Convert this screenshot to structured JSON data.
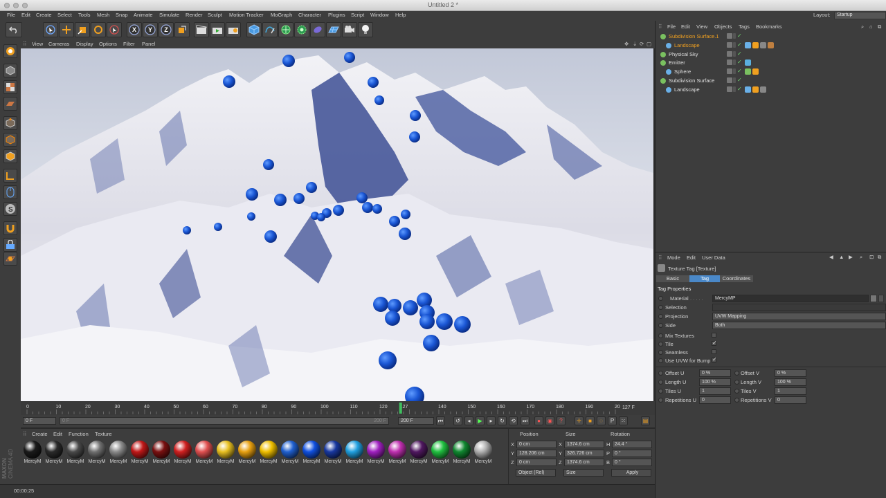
{
  "window": {
    "title": "Untitled 2 *"
  },
  "menubar": {
    "items": [
      "File",
      "Edit",
      "Create",
      "Select",
      "Tools",
      "Mesh",
      "Snap",
      "Animate",
      "Simulate",
      "Render",
      "Sculpt",
      "Motion Tracker",
      "MoGraph",
      "Character",
      "Plugins",
      "Script",
      "Window",
      "Help"
    ],
    "layout_label": "Layout:",
    "layout_value": "Startup"
  },
  "toolbar": {
    "axis_labels": [
      "X",
      "Y",
      "Z"
    ]
  },
  "viewport": {
    "menu": [
      "View",
      "Cameras",
      "Display",
      "Options",
      "Filter",
      "Panel"
    ]
  },
  "timeline": {
    "ticks": [
      "0",
      "10",
      "20",
      "30",
      "40",
      "50",
      "60",
      "70",
      "80",
      "90",
      "100",
      "110",
      "120",
      "127",
      "140",
      "150",
      "160",
      "170",
      "180",
      "190",
      "200"
    ],
    "current_frame_value": 127,
    "frame_display": "127 F"
  },
  "transport": {
    "start_frame": "0 F",
    "range_start": "0 F",
    "range_end": "200 F",
    "end_frame": "200 F"
  },
  "material_manager": {
    "menu": [
      "Create",
      "Edit",
      "Function",
      "Texture"
    ],
    "logo_line1": "MAXON",
    "logo_line2": "CINEMA 4D",
    "materials": [
      {
        "label": "MercyM",
        "color": "#1a1a1a"
      },
      {
        "label": "MercyM",
        "color": "#2a2a2a"
      },
      {
        "label": "MercyM",
        "color": "#4a4a4a"
      },
      {
        "label": "MercyM",
        "color": "#707070"
      },
      {
        "label": "MercyM",
        "color": "#8a8a8a"
      },
      {
        "label": "MercyM",
        "color": "#c01818"
      },
      {
        "label": "MercyM",
        "color": "#7a1010"
      },
      {
        "label": "MercyM",
        "color": "#d02020"
      },
      {
        "label": "MercyM",
        "color": "#e05050"
      },
      {
        "label": "MercyM",
        "color": "#e8c020"
      },
      {
        "label": "MercyM",
        "color": "#e8a010"
      },
      {
        "label": "MercyM",
        "color": "#f0c000"
      },
      {
        "label": "MercyM",
        "color": "#2060d0"
      },
      {
        "label": "MercyM",
        "color": "#1050e0"
      },
      {
        "label": "MercyM",
        "color": "#1838a0"
      },
      {
        "label": "MercyM",
        "color": "#20a0e0"
      },
      {
        "label": "MercyM",
        "color": "#a020c0"
      },
      {
        "label": "MercyM",
        "color": "#c030b0"
      },
      {
        "label": "MercyM",
        "color": "#501860"
      },
      {
        "label": "MercyM",
        "color": "#20c040"
      },
      {
        "label": "MercyM",
        "color": "#108830"
      },
      {
        "label": "MercyM",
        "color": "#b0b0b0"
      }
    ]
  },
  "coordinates": {
    "headers": [
      "Position",
      "Size",
      "Rotation"
    ],
    "rows": [
      {
        "axis": "X",
        "pos": "0 cm",
        "size": "1374.6 cm",
        "rot_axis": "H",
        "rot": "24.4 °"
      },
      {
        "axis": "Y",
        "pos": "128.206 cm",
        "size": "326.726 cm",
        "rot_axis": "P",
        "rot": "0 °"
      },
      {
        "axis": "Z",
        "pos": "0 cm",
        "size": "1374.6 cm",
        "rot_axis": "B",
        "rot": "0 °"
      }
    ],
    "mode": "Object (Rel)",
    "size_mode": "Size",
    "apply": "Apply"
  },
  "status": {
    "time": "00:00:25"
  },
  "object_manager": {
    "menu": [
      "File",
      "Edit",
      "View",
      "Objects",
      "Tags",
      "Bookmarks"
    ],
    "objects": [
      {
        "name": "Subdivision Surface.1",
        "selected": true,
        "indent": 0
      },
      {
        "name": "Landscape",
        "selected": true,
        "indent": 1
      },
      {
        "name": "Physical Sky",
        "selected": false,
        "indent": 0
      },
      {
        "name": "Emitter",
        "selected": false,
        "indent": 0
      },
      {
        "name": "Sphere",
        "selected": false,
        "indent": 1
      },
      {
        "name": "Subdivision Surface",
        "selected": false,
        "indent": 0
      },
      {
        "name": "Landscape",
        "selected": false,
        "indent": 1
      }
    ]
  },
  "attribute_manager": {
    "menu": [
      "Mode",
      "Edit",
      "User Data"
    ],
    "title": "Texture Tag [Texture]",
    "tabs": [
      "Basic",
      "Tag",
      "Coordinates"
    ],
    "active_tab": "Tag",
    "section": "Tag Properties",
    "material_label": "Material",
    "material_value": "MercyMP",
    "selection_label": "Selection",
    "projection_label": "Projection",
    "projection_value": "UVW Mapping",
    "side_label": "Side",
    "side_value": "Both",
    "mix_textures": "Mix Textures",
    "tile": "Tile",
    "seamless": "Seamless",
    "use_uvw_bump": "Use UVW for Bump",
    "offset_u_label": "Offset U",
    "offset_u": "0 %",
    "offset_v_label": "Offset V",
    "offset_v": "0 %",
    "length_u_label": "Length U",
    "length_u": "100 %",
    "length_v_label": "Length V",
    "length_v": "100 %",
    "tiles_u_label": "Tiles U",
    "tiles_u": "1",
    "tiles_v_label": "Tiles V",
    "tiles_v": "1",
    "repetitions_u_label": "Repetitions U",
    "repetitions_u": "0",
    "repetitions_v_label": "Repetitions V",
    "repetitions_v": "0"
  }
}
